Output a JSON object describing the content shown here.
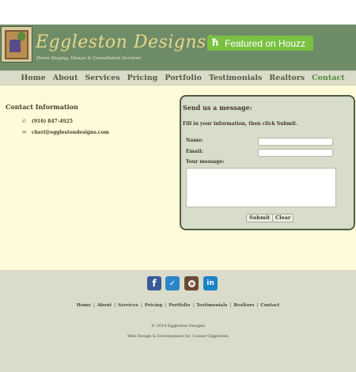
{
  "header": {
    "brand_name": "Eggleston Designs",
    "brand_mark": "®",
    "tagline": "Home Staging, Design & Consultation Services",
    "houzz_label": "Featured on Houzz",
    "houzz_icon": "houzz-icon"
  },
  "nav": {
    "items": [
      {
        "label": "Home"
      },
      {
        "label": "About"
      },
      {
        "label": "Services"
      },
      {
        "label": "Pricing"
      },
      {
        "label": "Portfolio"
      },
      {
        "label": "Testimonials"
      },
      {
        "label": "Realtors"
      },
      {
        "label": "Contact",
        "active": true
      }
    ]
  },
  "contact": {
    "title": "Contact Information",
    "phone": "(916) 847-4925",
    "email": "cheri@egglestondesigns.com"
  },
  "form": {
    "title": "Send us a message:",
    "instructions": "Fill in your information, then click Submit.",
    "name_label": "Name:",
    "email_label": "Email:",
    "message_label": "Your message:",
    "name_value": "",
    "email_value": "",
    "message_value": "",
    "submit_label": "Submit",
    "clear_label": "Clear"
  },
  "footer": {
    "social": [
      "facebook-icon",
      "twitter-icon",
      "instagram-icon",
      "linkedin-icon"
    ],
    "links": [
      "Home",
      "About",
      "Services",
      "Pricing",
      "Portfolio",
      "Testimonials",
      "Realtors",
      "Contact"
    ],
    "copyright": "© 2014 Eggleston Designs",
    "credit": "Web Design & Development by: Connor Eggleston"
  },
  "colors": {
    "header_bg": "#6f8c68",
    "nav_bg": "#dadcc9",
    "main_bg": "#fffad8",
    "houzz_green": "#7ac142",
    "active_nav": "#4f8a3a"
  }
}
